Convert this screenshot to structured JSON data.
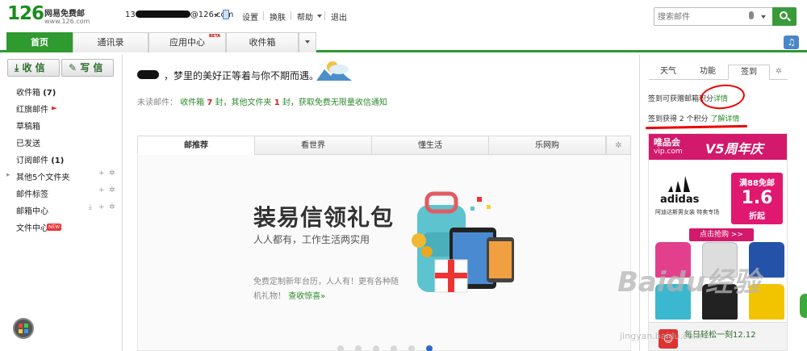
{
  "header": {
    "logo_number": "126",
    "logo_name": "网易免费邮",
    "logo_url": "www.126.com",
    "account_prefix": "13",
    "account_suffix": "@126.com",
    "links": [
      "设置",
      "换肤",
      "帮助",
      "退出"
    ],
    "search_placeholder": "搜索邮件"
  },
  "nav": {
    "tabs": [
      "首页",
      "通讯录",
      "应用中心",
      "收件箱"
    ],
    "beta": "BETA",
    "active_tab": "首页"
  },
  "sidebar": {
    "receive_label": "收 信",
    "compose_label": "写 信",
    "folders": [
      {
        "label": "收件箱",
        "count": "(7)"
      },
      {
        "label": "红旗邮件"
      },
      {
        "label": "草稿箱"
      },
      {
        "label": "已发送"
      },
      {
        "label": "订阅邮件",
        "count": "(1)"
      },
      {
        "label": "其他5个文件夹"
      },
      {
        "label": "邮件标签"
      },
      {
        "label": "邮箱中心"
      },
      {
        "label": "文件中心"
      }
    ],
    "new_badge": "NEW"
  },
  "main": {
    "greeting": "，梦里的美好正等着与你不期而遇。",
    "unread_label": "未读邮件：",
    "unread_inbox": "收件箱",
    "unread_inbox_count": "7",
    "unread_unit": "封",
    "unread_other": "，其他文件夹",
    "unread_other_count": "1",
    "unread_unit2": "封",
    "unread_promo": "，获取免费无限量收信通知",
    "feed_tabs": [
      "邮推荐",
      "看世界",
      "懂生活",
      "乐网购"
    ],
    "promo_title": "装易信领礼包",
    "promo_subtitle": "人人都有，工作生活两实用",
    "promo_desc": "免费定制新年台历，人人有！更有各种随机礼物！",
    "promo_link": "查收惊喜»",
    "pager_count": 6,
    "pager_active_index": 5
  },
  "right": {
    "tabs": [
      "天气",
      "功能",
      "签到"
    ],
    "active_tab": "签到",
    "sign_line1_prefix": "签到可获赠邮箱积分",
    "sign_line1_link": "详情",
    "sign_line2_prefix": "签到获得",
    "sign_line2_num": "2",
    "sign_line2_mid": "个积分",
    "sign_line2_link": "了解详情",
    "ad_brand": "唯品会",
    "ad_url": "vip.com",
    "ad_anniv": "V5周年庆",
    "ad_logo": "adidas",
    "ad_logo_sub": "阿迪达斯男女装 特卖专场",
    "ad_badge_title": "满88免邮",
    "ad_badge_num": "1.6",
    "ad_badge_unit": "折起",
    "ad_cta": "点击抢购 >>",
    "ad_strip_text": "每日轻松一刻12.12"
  },
  "watermark": {
    "text": "Baidu经验",
    "url": "jingyan.baidu.com"
  },
  "colors": {
    "brand_green": "#2f9a2f",
    "accent_red": "#d02020",
    "ad_pink": "#d3196b"
  }
}
